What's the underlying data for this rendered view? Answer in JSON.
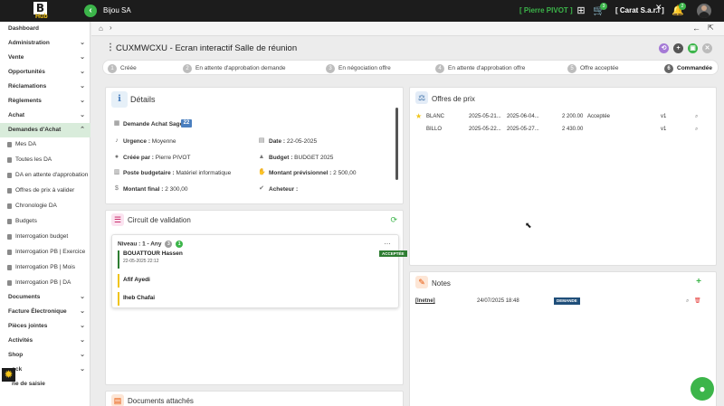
{
  "header": {
    "logo_letter": "B",
    "logo_sub": "Hub",
    "company": "Bijou SA",
    "user": "[ Pierre PIVOT ]",
    "cart_badge": "3",
    "tenant": "[ Carat S.a.r.l ]",
    "notif_badge": "2"
  },
  "sidebar": {
    "items": [
      {
        "label": "Dashboard"
      },
      {
        "label": "Administration"
      },
      {
        "label": "Vente"
      },
      {
        "label": "Opportunités"
      },
      {
        "label": "Réclamations"
      },
      {
        "label": "Règlements"
      },
      {
        "label": "Achat"
      },
      {
        "label": "Demandes d'Achat"
      }
    ],
    "subitems": [
      {
        "label": "Mes DA"
      },
      {
        "label": "Toutes les DA"
      },
      {
        "label": "DA en attente d'approbation"
      },
      {
        "label": "Offres de prix à valider"
      },
      {
        "label": "Chronologie DA"
      },
      {
        "label": "Budgets"
      },
      {
        "label": "Interrogation budget"
      },
      {
        "label": "Interrogation PB | Exercice"
      },
      {
        "label": "Interrogation PB | Mois"
      },
      {
        "label": "Interrogation PB | DA"
      }
    ],
    "items2": [
      {
        "label": "Documents"
      },
      {
        "label": "Facture Électronique"
      },
      {
        "label": "Pièces jointes"
      },
      {
        "label": "Activités"
      },
      {
        "label": "Shop"
      },
      {
        "label": "ock"
      }
    ],
    "footer_label": "ne de saisie"
  },
  "page": {
    "title": "CUXMWCXU - Ecran interactif Salle de réunion"
  },
  "stepper": [
    {
      "num": "1",
      "label": "Créée"
    },
    {
      "num": "2",
      "label": "En attente d'approbation demande"
    },
    {
      "num": "3",
      "label": "En négociation offre"
    },
    {
      "num": "4",
      "label": "En attente d'approbation offre"
    },
    {
      "num": "5",
      "label": "Offre acceptée"
    },
    {
      "num": "6",
      "label": "Commandée"
    }
  ],
  "details": {
    "title": "Détails",
    "sage_label": "Demande Achat Sage :",
    "sage_value": "22",
    "urgence_label": "Urgence :",
    "urgence_value": "Moyenne",
    "date_label": "Date :",
    "date_value": "22-05-2025",
    "creee_label": "Créée par :",
    "creee_value": "Pierre PIVOT",
    "budget_label": "Budget :",
    "budget_value": "BUDGET 2025",
    "poste_label": "Poste budgetaire :",
    "poste_value": "Matériel informatique",
    "montant_prev_label": "Montant prévisionnel :",
    "montant_prev_value": "2 500,00",
    "montant_final_label": "Montant final :",
    "montant_final_value": "2 300,00",
    "acheteur_label": "Acheteur :"
  },
  "offres": {
    "title": "Offres de prix",
    "rows": [
      {
        "name": "BLANC",
        "d1": "2025-05-21...",
        "d2": "2025-06-04...",
        "amount": "2 200.00",
        "status": "Acceptée",
        "version": "v1"
      },
      {
        "name": "BILLO",
        "d1": "2025-05-22...",
        "d2": "2025-05-27...",
        "amount": "2 430.00",
        "status": "",
        "version": "v1"
      }
    ]
  },
  "circuit": {
    "title": "Circuit de validation",
    "niveau": "Niveau : 1 - Any",
    "badge1": "3",
    "badge2": "1",
    "approvers": [
      {
        "name": "BOUATTOUR Hassen",
        "date": "22-05-2025 22:12",
        "status": "ACCEPTÉE"
      },
      {
        "name": "Afif Ayedi"
      },
      {
        "name": "Iheb Chafai"
      }
    ]
  },
  "notes": {
    "title": "Notes",
    "rows": [
      {
        "author": "[Inetne]",
        "date": "24/07/2025 18:48",
        "badge": "DEMANDE"
      }
    ]
  },
  "documents": {
    "title": "Documents attachés"
  }
}
